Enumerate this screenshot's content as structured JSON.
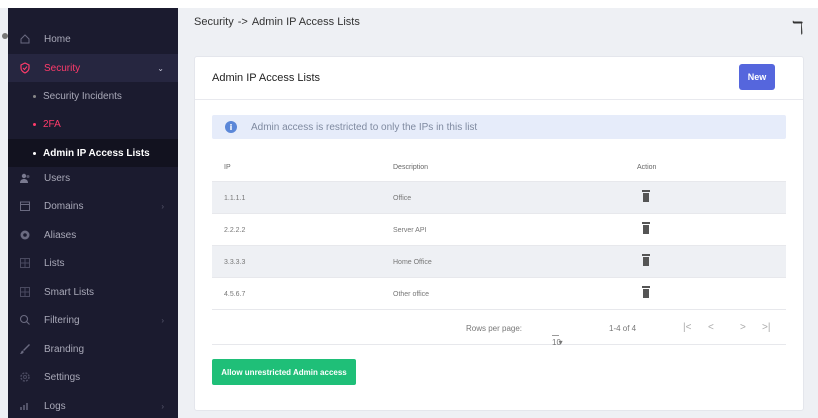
{
  "breadcrumb": {
    "parent": "Security",
    "separator": "->",
    "current": "Admin IP Access Lists"
  },
  "sidebar": {
    "items": [
      {
        "label": "Home",
        "icon": "home-icon"
      },
      {
        "label": "Security",
        "icon": "shield-icon",
        "chevron": "⌄"
      },
      {
        "label": "Security Incidents"
      },
      {
        "label": "2FA"
      },
      {
        "label": "Admin IP Access Lists"
      },
      {
        "label": "Users",
        "icon": "users-icon"
      },
      {
        "label": "Domains",
        "icon": "calendar-icon",
        "chevron": "›"
      },
      {
        "label": "Aliases",
        "icon": "aliases-icon"
      },
      {
        "label": "Lists",
        "icon": "lists-icon"
      },
      {
        "label": "Smart Lists",
        "icon": "smart-lists-icon"
      },
      {
        "label": "Filtering",
        "icon": "search-icon",
        "chevron": "›"
      },
      {
        "label": "Branding",
        "icon": "brush-icon"
      },
      {
        "label": "Settings",
        "icon": "gear-icon"
      },
      {
        "label": "Logs",
        "icon": "logs-icon",
        "chevron": "›"
      }
    ]
  },
  "card": {
    "title": "Admin IP Access Lists",
    "new_label": "New",
    "alert": "Admin access is restricted to only the IPs in this list",
    "alert_icon": "i",
    "columns": {
      "ip": "IP",
      "description": "Description",
      "action": "Action"
    },
    "rows": [
      {
        "ip": "1.1.1.1",
        "description": "Office"
      },
      {
        "ip": "2.2.2.2",
        "description": "Server API"
      },
      {
        "ip": "3.3.3.3",
        "description": "Home Office"
      },
      {
        "ip": "4.5.6.7",
        "description": "Other office"
      }
    ],
    "pagination": {
      "rows_per_page_label": "Rows per page:",
      "rows_per_page_value": "10",
      "dropdown_arrow": "▾",
      "range": "1-4 of 4",
      "first": "|<",
      "prev": "<",
      "next": ">",
      "last": ">|"
    },
    "allow_label": "Allow unrestricted Admin access"
  },
  "colors": {
    "sidebar_bg": "#1b1b2f",
    "accent_red": "#ff3b6b",
    "primary": "#5566dd",
    "success": "#1fbf78"
  },
  "stray_glyph": "ℸ"
}
